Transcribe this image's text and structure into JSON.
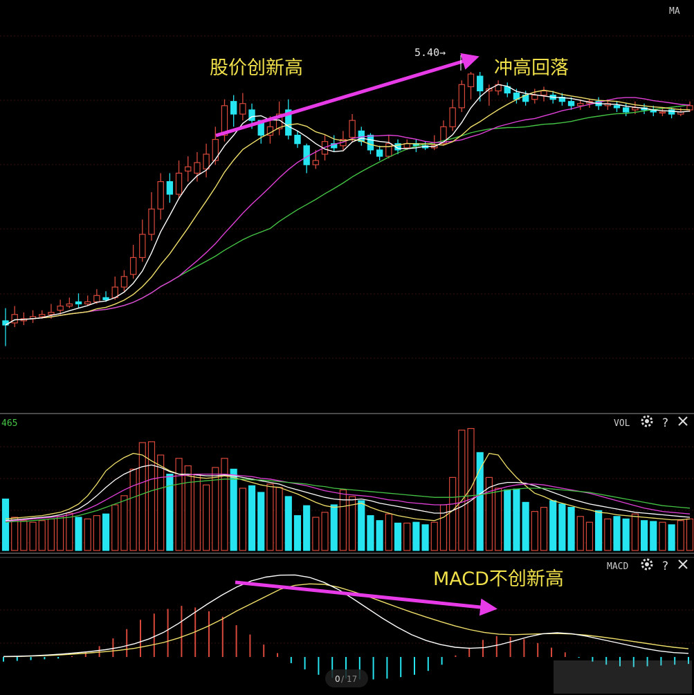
{
  "colors": {
    "background": "#000000",
    "grid": "#3a1010",
    "up_candle": "#d9493b",
    "down_candle": "#26e5f0",
    "ma5": "#ffffff",
    "ma10": "#f0e06a",
    "ma20": "#e040d8",
    "ma30": "#44c444",
    "arrow": "#e83be8",
    "annotation": "#f0e04a"
  },
  "panels": {
    "price": {
      "indicator_label": "MA"
    },
    "volume": {
      "indicator_label": "VOL",
      "value_label": "465"
    },
    "macd": {
      "indicator_label": "MACD"
    }
  },
  "icons": [
    "gear-icon",
    "help-icon",
    "close-icon"
  ],
  "annotations": {
    "price_high_label": "5.40→",
    "price_new_high": "股价创新高",
    "rush_high_fall": "冲高回落",
    "macd_no_new_high": "MACD不创新高"
  },
  "pager": {
    "current": "0",
    "separator": "/",
    "total": "17"
  },
  "chart_data": {
    "type": "candlestick",
    "candles": [
      [
        4.22,
        4.2,
        4.28,
        4.1
      ],
      [
        4.21,
        4.25,
        4.29,
        4.19
      ],
      [
        4.22,
        4.23,
        4.26,
        4.2
      ],
      [
        4.23,
        4.24,
        4.27,
        4.21
      ],
      [
        4.24,
        4.25,
        4.27,
        4.23
      ],
      [
        4.25,
        4.26,
        4.3,
        4.23
      ],
      [
        4.27,
        4.29,
        4.32,
        4.25
      ],
      [
        4.29,
        4.3,
        4.33,
        4.28
      ],
      [
        4.31,
        4.3,
        4.35,
        4.28
      ],
      [
        4.3,
        4.31,
        4.34,
        4.29
      ],
      [
        4.31,
        4.34,
        4.37,
        4.3
      ],
      [
        4.33,
        4.32,
        4.36,
        4.31
      ],
      [
        4.33,
        4.38,
        4.43,
        4.32
      ],
      [
        4.38,
        4.43,
        4.46,
        4.36
      ],
      [
        4.44,
        4.52,
        4.58,
        4.42
      ],
      [
        4.52,
        4.63,
        4.7,
        4.5
      ],
      [
        4.63,
        4.75,
        4.83,
        4.6
      ],
      [
        4.75,
        4.88,
        4.92,
        4.7
      ],
      [
        4.88,
        4.82,
        4.92,
        4.78
      ],
      [
        4.82,
        4.92,
        4.98,
        4.8
      ],
      [
        4.93,
        4.95,
        5.0,
        4.88
      ],
      [
        4.92,
        4.97,
        5.02,
        4.88
      ],
      [
        4.94,
        5.01,
        5.06,
        4.9
      ],
      [
        4.98,
        5.08,
        5.14,
        4.96
      ],
      [
        5.1,
        5.24,
        5.27,
        5.07
      ],
      [
        5.26,
        5.2,
        5.29,
        5.14
      ],
      [
        5.2,
        5.25,
        5.3,
        5.17
      ],
      [
        5.22,
        5.17,
        5.25,
        5.13
      ],
      [
        5.17,
        5.1,
        5.16,
        5.06
      ],
      [
        5.1,
        5.14,
        5.19,
        5.06
      ],
      [
        5.13,
        5.2,
        5.26,
        5.1
      ],
      [
        5.22,
        5.1,
        5.27,
        5.08
      ],
      [
        5.1,
        5.06,
        5.12,
        5.04
      ],
      [
        5.05,
        4.96,
        5.06,
        4.92
      ],
      [
        4.96,
        4.98,
        5.03,
        4.94
      ],
      [
        5.01,
        5.07,
        5.1,
        4.98
      ],
      [
        5.06,
        5.04,
        5.1,
        5.02
      ],
      [
        5.05,
        5.08,
        5.12,
        5.03
      ],
      [
        5.09,
        5.17,
        5.2,
        5.07
      ],
      [
        5.12,
        5.07,
        5.14,
        5.05
      ],
      [
        5.1,
        5.03,
        5.11,
        5.01
      ],
      [
        5.03,
        5.0,
        5.05,
        4.98
      ],
      [
        5.0,
        5.06,
        5.1,
        4.99
      ],
      [
        5.06,
        5.03,
        5.08,
        5.01
      ],
      [
        5.04,
        5.06,
        5.08,
        5.03
      ],
      [
        5.06,
        5.05,
        5.08,
        5.02
      ],
      [
        5.05,
        5.04,
        5.07,
        5.03
      ],
      [
        5.04,
        5.05,
        5.1,
        5.03
      ],
      [
        5.06,
        5.14,
        5.17,
        5.05
      ],
      [
        5.14,
        5.23,
        5.27,
        5.12
      ],
      [
        5.23,
        5.34,
        5.36,
        5.21
      ],
      [
        5.33,
        5.39,
        5.4,
        5.27
      ],
      [
        5.38,
        5.31,
        5.4,
        5.26
      ],
      [
        5.31,
        5.32,
        5.34,
        5.24
      ],
      [
        5.31,
        5.34,
        5.36,
        5.29
      ],
      [
        5.33,
        5.3,
        5.35,
        5.28
      ],
      [
        5.3,
        5.27,
        5.32,
        5.25
      ],
      [
        5.29,
        5.26,
        5.31,
        5.24
      ],
      [
        5.27,
        5.29,
        5.32,
        5.25
      ],
      [
        5.29,
        5.31,
        5.33,
        5.26
      ],
      [
        5.29,
        5.27,
        5.31,
        5.25
      ],
      [
        5.28,
        5.26,
        5.3,
        5.24
      ],
      [
        5.26,
        5.24,
        5.28,
        5.22
      ],
      [
        5.24,
        5.25,
        5.27,
        5.22
      ],
      [
        5.25,
        5.26,
        5.27,
        5.23
      ],
      [
        5.26,
        5.24,
        5.28,
        5.22
      ],
      [
        5.24,
        5.25,
        5.27,
        5.22
      ],
      [
        5.24,
        5.23,
        5.26,
        5.21
      ],
      [
        5.23,
        5.21,
        5.25,
        5.19
      ],
      [
        5.22,
        5.23,
        5.26,
        5.2
      ],
      [
        5.23,
        5.22,
        5.25,
        5.2
      ],
      [
        5.22,
        5.21,
        5.24,
        5.19
      ],
      [
        5.21,
        5.21,
        5.23,
        5.19
      ],
      [
        5.22,
        5.2,
        5.23,
        5.18
      ],
      [
        5.2,
        5.21,
        5.23,
        5.19
      ],
      [
        5.22,
        5.24,
        5.26,
        5.21
      ]
    ],
    "volume": [
      62,
      40,
      36,
      34,
      36,
      38,
      41,
      45,
      40,
      38,
      42,
      44,
      55,
      66,
      98,
      130,
      131,
      115,
      92,
      111,
      102,
      92,
      79,
      100,
      111,
      98,
      75,
      78,
      70,
      80,
      76,
      65,
      42,
      54,
      40,
      46,
      55,
      73,
      65,
      60,
      42,
      36,
      44,
      33,
      33,
      34,
      31,
      34,
      55,
      88,
      145,
      147,
      118,
      88,
      75,
      73,
      74,
      58,
      47,
      52,
      60,
      56,
      52,
      41,
      34,
      48,
      38,
      41,
      38,
      44,
      36,
      35,
      34,
      31,
      36,
      38
    ],
    "ma_volume": [
      [
        38,
        39,
        40,
        41,
        42,
        44,
        46,
        50,
        56,
        66,
        80,
        96,
        105,
        112,
        117,
        115,
        108,
        102,
        96,
        92,
        90,
        88,
        87,
        88,
        90,
        88,
        85,
        82,
        79,
        77,
        76,
        72,
        68,
        63,
        58,
        54,
        52,
        53,
        55,
        57,
        52,
        48,
        45,
        42,
        40,
        38,
        37,
        36,
        40,
        48,
        60,
        75,
        98,
        117,
        115,
        100,
        88,
        78,
        69,
        65,
        60,
        57,
        54,
        51,
        49,
        46,
        45,
        43,
        42,
        41,
        40,
        39,
        38,
        37,
        37,
        38
      ],
      [
        36,
        37,
        38,
        39,
        40,
        41,
        43,
        46,
        50,
        57,
        66,
        76,
        85,
        92,
        97,
        101,
        103,
        100,
        95,
        92,
        92,
        91,
        90,
        90,
        91,
        90,
        88,
        86,
        84,
        82,
        80,
        76,
        73,
        70,
        67,
        64,
        62,
        61,
        61,
        62,
        60,
        57,
        55,
        53,
        51,
        49,
        47,
        45,
        45,
        48,
        53,
        60,
        68,
        76,
        80,
        82,
        82,
        81,
        78,
        74,
        70,
        66,
        62,
        59,
        56,
        54,
        52,
        50,
        48,
        46,
        45,
        44,
        43,
        42,
        41,
        40
      ],
      [
        35,
        36,
        37,
        38,
        39,
        40,
        41,
        43,
        46,
        50,
        55,
        61,
        67,
        73,
        78,
        82,
        86,
        88,
        89,
        90,
        91,
        92,
        92,
        92,
        92,
        91,
        90,
        89,
        87,
        86,
        84,
        82,
        80,
        78,
        75,
        72,
        70,
        68,
        67,
        66,
        65,
        63,
        61,
        60,
        58,
        57,
        56,
        55,
        55,
        56,
        58,
        62,
        67,
        71,
        74,
        77,
        79,
        80,
        80,
        79,
        77,
        75,
        73,
        71,
        69,
        66,
        63,
        60,
        57,
        54,
        51,
        49,
        47,
        46,
        45,
        44
      ],
      [
        34,
        35,
        35,
        36,
        37,
        38,
        39,
        40,
        42,
        45,
        48,
        52,
        56,
        60,
        64,
        68,
        72,
        75,
        78,
        80,
        82,
        83,
        84,
        85,
        86,
        86,
        86,
        85,
        85,
        84,
        83,
        82,
        81,
        80,
        78,
        77,
        75,
        74,
        73,
        72,
        71,
        70,
        69,
        68,
        67,
        66,
        65,
        64,
        64,
        64,
        65,
        66,
        67,
        69,
        71,
        73,
        74,
        75,
        75,
        75,
        74,
        73,
        72,
        71,
        70,
        68,
        66,
        64,
        62,
        60,
        58,
        56,
        54,
        53,
        52,
        51
      ]
    ],
    "macd": {
      "dif": [
        0.2,
        0.3,
        0.5,
        0.8,
        1.2,
        1.7,
        2.3,
        3.0,
        4.0,
        5.5,
        7.5,
        10.2,
        13.8,
        17.9,
        21.9,
        25.6,
        28.9,
        31.4,
        33.0,
        33.8,
        33.9,
        32.9,
        30.8,
        27.8,
        24.0,
        20.0,
        16.0,
        12.4,
        9.2,
        6.8,
        5.1,
        4.0,
        3.6,
        3.9,
        5.0,
        6.6,
        8.3,
        9.6,
        10.0,
        9.6,
        8.6,
        7.3,
        6.0,
        4.7,
        3.5,
        2.5,
        1.8,
        1.5
      ],
      "dea": [
        0.1,
        0.2,
        0.4,
        0.6,
        0.9,
        1.3,
        1.7,
        2.2,
        2.8,
        3.6,
        4.7,
        6.0,
        7.8,
        10.0,
        12.6,
        15.6,
        19.0,
        22.0,
        25.0,
        28.0,
        29.6,
        30.2,
        30.0,
        28.8,
        27.0,
        25.0,
        22.8,
        20.6,
        18.5,
        16.5,
        14.6,
        12.8,
        11.3,
        10.1,
        9.4,
        9.2,
        9.4,
        9.6,
        9.7,
        9.5,
        9.0,
        8.3,
        7.5,
        6.6,
        5.7,
        4.8,
        4.0,
        3.4
      ],
      "hist": [
        -0.6,
        -0.5,
        -0.4,
        -0.3,
        -0.2,
        0.1,
        0.6,
        1.4,
        2.4,
        3.6,
        4.8,
        5.6,
        6.2,
        6.6,
        6.4,
        5.9,
        5.2,
        4.1,
        2.9,
        1.6,
        0.5,
        -0.8,
        -1.6,
        -2.3,
        -2.7,
        -2.8,
        -2.9,
        -2.9,
        -2.8,
        -2.6,
        -2.3,
        -1.8,
        -1.0,
        0.2,
        1.2,
        2.2,
        2.7,
        2.6,
        2.3,
        1.8,
        1.2,
        0.6,
        -0.1,
        -0.6,
        -1.0,
        -1.2,
        -1.3,
        -1.2,
        -1.1,
        -1.0,
        -0.9
      ]
    }
  }
}
